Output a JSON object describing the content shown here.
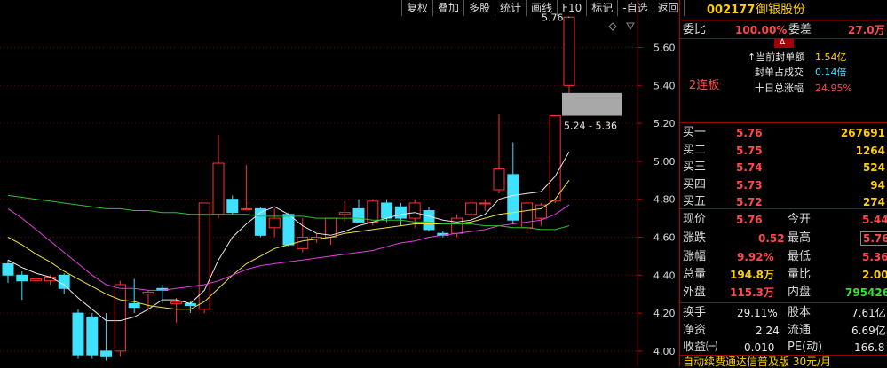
{
  "toolbar": {
    "items": [
      "复权",
      "叠加",
      "多股",
      "统计",
      "画线",
      "F10",
      "标记",
      "-自选",
      "返回"
    ]
  },
  "chart": {
    "price_labels": [
      "5.60",
      "5.40",
      "5.20",
      "5.00",
      "4.80",
      "4.60",
      "4.40",
      "4.20",
      "4.00"
    ],
    "peak_label": "5.76",
    "range_label": "5.24 - 5.36",
    "y_min": 3.92,
    "y_max": 5.85
  },
  "chart_data": {
    "type": "candlestick",
    "ylim": [
      3.92,
      5.85
    ],
    "tick_labels": [
      "5.60",
      "5.40",
      "5.20",
      "5.00",
      "4.80",
      "4.60",
      "4.40",
      "4.20",
      "4.00"
    ],
    "annotations": [
      "5.76",
      "5.24 - 5.36"
    ],
    "candles": [
      {
        "o": 4.46,
        "h": 4.48,
        "l": 4.36,
        "c": 4.4
      },
      {
        "o": 4.4,
        "h": 4.42,
        "l": 4.27,
        "c": 4.37
      },
      {
        "o": 4.37,
        "h": 4.39,
        "l": 4.36,
        "c": 4.38
      },
      {
        "o": 4.37,
        "h": 4.4,
        "l": 4.35,
        "c": 4.39
      },
      {
        "o": 4.4,
        "h": 4.41,
        "l": 4.3,
        "c": 4.33
      },
      {
        "o": 4.2,
        "h": 4.22,
        "l": 3.96,
        "c": 3.98
      },
      {
        "o": 4.18,
        "h": 4.2,
        "l": 3.96,
        "c": 3.98
      },
      {
        "o": 4.0,
        "h": 4.2,
        "l": 3.95,
        "c": 3.97
      },
      {
        "o": 4.0,
        "h": 4.37,
        "l": 3.97,
        "c": 4.35
      },
      {
        "o": 4.25,
        "h": 4.38,
        "l": 4.2,
        "c": 4.23
      },
      {
        "o": 4.3,
        "h": 4.32,
        "l": 4.22,
        "c": 4.31
      },
      {
        "o": 4.33,
        "h": 4.35,
        "l": 4.25,
        "c": 4.32
      },
      {
        "o": 4.25,
        "h": 4.28,
        "l": 4.15,
        "c": 4.26
      },
      {
        "o": 4.25,
        "h": 4.26,
        "l": 4.2,
        "c": 4.24
      },
      {
        "o": 4.22,
        "h": 4.78,
        "l": 4.2,
        "c": 4.78
      },
      {
        "o": 4.72,
        "h": 5.14,
        "l": 4.7,
        "c": 4.99
      },
      {
        "o": 4.8,
        "h": 4.82,
        "l": 4.72,
        "c": 4.73
      },
      {
        "o": 4.75,
        "h": 4.98,
        "l": 4.74,
        "c": 4.75
      },
      {
        "o": 4.75,
        "h": 4.76,
        "l": 4.6,
        "c": 4.61
      },
      {
        "o": 4.65,
        "h": 4.75,
        "l": 4.6,
        "c": 4.7
      },
      {
        "o": 4.72,
        "h": 4.73,
        "l": 4.55,
        "c": 4.56
      },
      {
        "o": 4.54,
        "h": 4.7,
        "l": 4.52,
        "c": 4.6
      },
      {
        "o": 4.59,
        "h": 4.62,
        "l": 4.57,
        "c": 4.6
      },
      {
        "o": 4.6,
        "h": 4.7,
        "l": 4.56,
        "c": 4.7
      },
      {
        "o": 4.72,
        "h": 4.79,
        "l": 4.68,
        "c": 4.73
      },
      {
        "o": 4.75,
        "h": 4.8,
        "l": 4.68,
        "c": 4.68
      },
      {
        "o": 4.68,
        "h": 4.8,
        "l": 4.66,
        "c": 4.79
      },
      {
        "o": 4.78,
        "h": 4.8,
        "l": 4.68,
        "c": 4.7
      },
      {
        "o": 4.76,
        "h": 4.78,
        "l": 4.66,
        "c": 4.7
      },
      {
        "o": 4.7,
        "h": 4.8,
        "l": 4.65,
        "c": 4.78
      },
      {
        "o": 4.74,
        "h": 4.76,
        "l": 4.63,
        "c": 4.64
      },
      {
        "o": 4.62,
        "h": 4.63,
        "l": 4.6,
        "c": 4.61
      },
      {
        "o": 4.62,
        "h": 4.72,
        "l": 4.6,
        "c": 4.7
      },
      {
        "o": 4.72,
        "h": 4.8,
        "l": 4.7,
        "c": 4.78
      },
      {
        "o": 4.78,
        "h": 4.8,
        "l": 4.74,
        "c": 4.78
      },
      {
        "o": 4.85,
        "h": 5.25,
        "l": 4.83,
        "c": 4.96
      },
      {
        "o": 4.93,
        "h": 5.1,
        "l": 4.67,
        "c": 4.69
      },
      {
        "o": 4.65,
        "h": 4.8,
        "l": 4.62,
        "c": 4.78
      },
      {
        "o": 4.7,
        "h": 4.78,
        "l": 4.66,
        "c": 4.77
      },
      {
        "o": 4.79,
        "h": 5.24,
        "l": 4.78,
        "c": 5.24
      },
      {
        "o": 5.4,
        "h": 5.76,
        "l": 5.36,
        "c": 5.76
      }
    ],
    "ma_series": [
      {
        "color": "#e8e8e8",
        "values": [
          4.48,
          4.44,
          4.41,
          4.39,
          4.35,
          4.28,
          4.22,
          4.16,
          4.16,
          4.18,
          4.22,
          4.27,
          4.27,
          4.25,
          4.32,
          4.48,
          4.6,
          4.67,
          4.73,
          4.76,
          4.72,
          4.66,
          4.62,
          4.61,
          4.63,
          4.66,
          4.68,
          4.7,
          4.72,
          4.73,
          4.71,
          4.69,
          4.68,
          4.69,
          4.72,
          4.8,
          4.82,
          4.83,
          4.84,
          4.92,
          5.05
        ]
      },
      {
        "color": "#f0e040",
        "values": [
          4.6,
          4.56,
          4.51,
          4.47,
          4.42,
          4.38,
          4.34,
          4.3,
          4.27,
          4.26,
          4.24,
          4.23,
          4.22,
          4.22,
          4.26,
          4.33,
          4.4,
          4.46,
          4.5,
          4.54,
          4.56,
          4.58,
          4.59,
          4.6,
          4.62,
          4.63,
          4.64,
          4.65,
          4.66,
          4.67,
          4.67,
          4.67,
          4.67,
          4.68,
          4.7,
          4.72,
          4.73,
          4.74,
          4.75,
          4.8,
          4.9
        ]
      },
      {
        "color": "#e040e0",
        "values": [
          4.75,
          4.7,
          4.64,
          4.58,
          4.52,
          4.46,
          4.4,
          4.35,
          4.33,
          4.33,
          4.32,
          4.32,
          4.33,
          4.34,
          4.35,
          4.37,
          4.4,
          4.43,
          4.45,
          4.46,
          4.47,
          4.48,
          4.49,
          4.5,
          4.51,
          4.52,
          4.53,
          4.55,
          4.57,
          4.58,
          4.6,
          4.61,
          4.62,
          4.63,
          4.64,
          4.66,
          4.67,
          4.68,
          4.69,
          4.72,
          4.77
        ]
      },
      {
        "color": "#30c030",
        "values": [
          4.82,
          4.81,
          4.8,
          4.79,
          4.78,
          4.77,
          4.76,
          4.75,
          4.75,
          4.74,
          4.74,
          4.73,
          4.73,
          4.72,
          4.72,
          4.72,
          4.72,
          4.72,
          4.71,
          4.71,
          4.71,
          4.71,
          4.7,
          4.7,
          4.7,
          4.7,
          4.69,
          4.69,
          4.69,
          4.68,
          4.68,
          4.67,
          4.67,
          4.67,
          4.66,
          4.66,
          4.65,
          4.65,
          4.64,
          4.64,
          4.66
        ]
      }
    ]
  },
  "quote": {
    "code": "002177",
    "name": "御银股份",
    "weibi_label": "委比",
    "weibi": "100.00%",
    "weicha_label": "委差",
    "weicha": "27.0万",
    "arrow_glyph": "ᐃ",
    "streak": "2连板",
    "seal_amount_label": "当前封单额",
    "seal_amount": "1.54亿",
    "seal_ratio_label": "封单占成交",
    "seal_ratio": "0.14倍",
    "ten_day_label": "十日总涨幅",
    "ten_day": "24.95%",
    "buy": [
      {
        "label": "买一",
        "price": "5.76",
        "vol": "267691"
      },
      {
        "label": "买二",
        "price": "5.75",
        "vol": "1264"
      },
      {
        "label": "买三",
        "price": "5.74",
        "vol": "524"
      },
      {
        "label": "买四",
        "price": "5.73",
        "vol": "94"
      },
      {
        "label": "买五",
        "price": "5.72",
        "vol": "274"
      }
    ],
    "xianjia_label": "现价",
    "xianjia": "5.76",
    "jinkai_label": "今开",
    "jinkai": "5.44",
    "zhangdie_label": "涨跌",
    "zhangdie": "0.52",
    "zuigao_label": "最高",
    "zuigao": "5.76",
    "zhangfu_label": "涨幅",
    "zhangfu": "9.92%",
    "zuidi_label": "最低",
    "zuidi": "5.36",
    "zongliang_label": "总量",
    "zongliang": "194.8万",
    "liangbi_label": "量比",
    "liangbi": "2.00",
    "waipan_label": "外盘",
    "waipan": "115.3万",
    "neipan_label": "内盘",
    "neipan": "795426",
    "huanshou_label": "换手",
    "huanshou": "29.11%",
    "guben_label": "股本",
    "guben": "7.61亿",
    "jingzi_label": "净资",
    "jingzi": "2.24",
    "liutong_label": "流通",
    "liutong": "6.69亿",
    "shouyi_label": "收益㈠",
    "shouyi": "0.010",
    "pe_label": "PE(动)",
    "pe": "166.8",
    "ad_text": "自动续费通达信普及版 30元/月"
  },
  "colors": {
    "up": "#ff3030",
    "down": "#40e0ff",
    "grid": "#700000",
    "panel_line": "#a00000"
  }
}
